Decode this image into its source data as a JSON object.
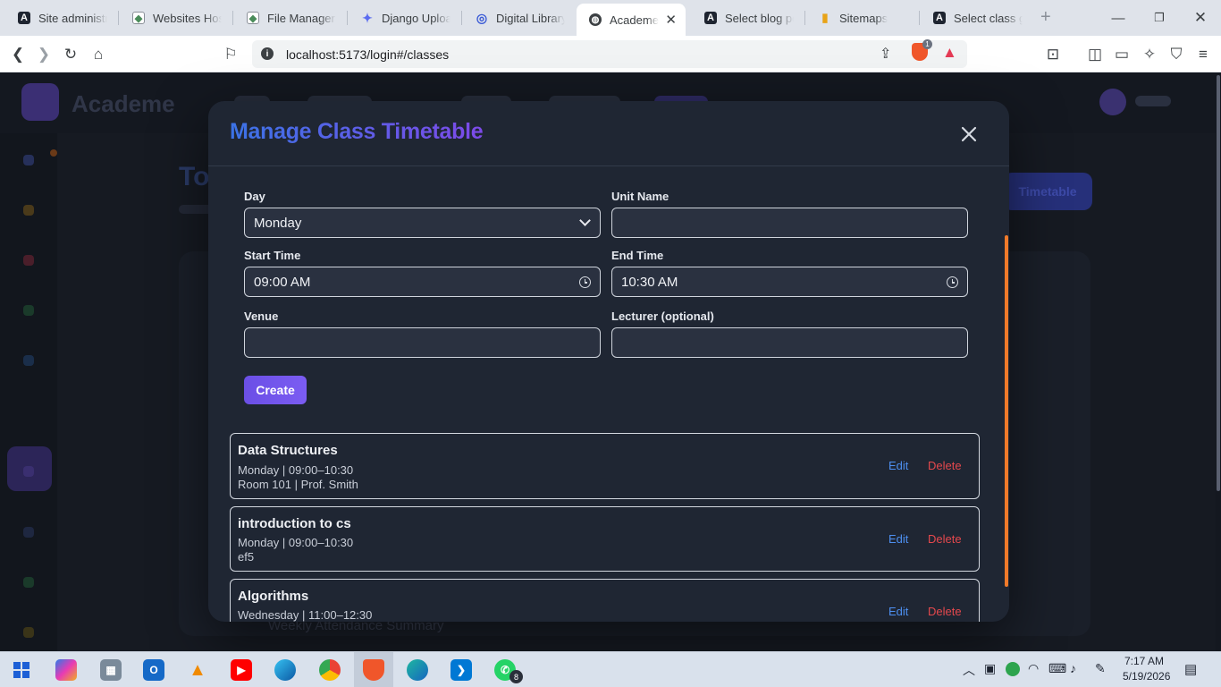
{
  "browser": {
    "tabs": [
      {
        "label": "Site administra",
        "icon": "admin-icon"
      },
      {
        "label": "Websites Hosti",
        "icon": "hosting-icon"
      },
      {
        "label": "File Manager -",
        "icon": "file-manager-icon"
      },
      {
        "label": "Django Uploa",
        "icon": "gemini-icon"
      },
      {
        "label": "Digital Library",
        "icon": "library-icon"
      },
      {
        "label": "Academe",
        "icon": "globe-icon",
        "active": true
      },
      {
        "label": "Select blog po",
        "icon": "admin-icon"
      },
      {
        "label": "Sitemaps",
        "icon": "analytics-icon"
      },
      {
        "label": "Select class gro",
        "icon": "admin-icon"
      }
    ],
    "url": "localhost:5173/login#/classes",
    "shield_badge": "1"
  },
  "app": {
    "brand": "Academe",
    "bg_title_fragment": "To",
    "bg_button_label": "Timetable",
    "bg_row_label": "Weekly Attendance Summary"
  },
  "modal": {
    "title": "Manage Class Timetable",
    "form": {
      "day_label": "Day",
      "day_value": "Monday",
      "unit_label": "Unit Name",
      "unit_value": "",
      "start_label": "Start Time",
      "start_value": "09:00 AM",
      "end_label": "End Time",
      "end_value": "10:30 AM",
      "venue_label": "Venue",
      "venue_value": "",
      "lecturer_label": "Lecturer (optional)",
      "lecturer_value": "",
      "create_label": "Create"
    },
    "classes": [
      {
        "name": "Data Structures",
        "schedule": "Monday | 09:00–10:30",
        "details": "Room 101 | Prof. Smith",
        "edit": "Edit",
        "delete": "Delete"
      },
      {
        "name": "introduction to cs",
        "schedule": "Monday | 09:00–10:30",
        "details": "ef5",
        "edit": "Edit",
        "delete": "Delete"
      },
      {
        "name": "Algorithms",
        "schedule": "Wednesday | 11:00–12:30",
        "details": "",
        "edit": "Edit",
        "delete": "Delete"
      }
    ]
  },
  "taskbar": {
    "whatsapp_badge": "8",
    "time": "7:17 AM",
    "date": "5/19/2026"
  },
  "colors": {
    "title_gradient_start": "#3b73e6",
    "title_gradient_end": "#7d4ae8",
    "create_button": "#6b4fe6",
    "edit_link": "#4d8ff0",
    "delete_link": "#e5484d",
    "modal_scrollbar": "#f07a2a"
  }
}
